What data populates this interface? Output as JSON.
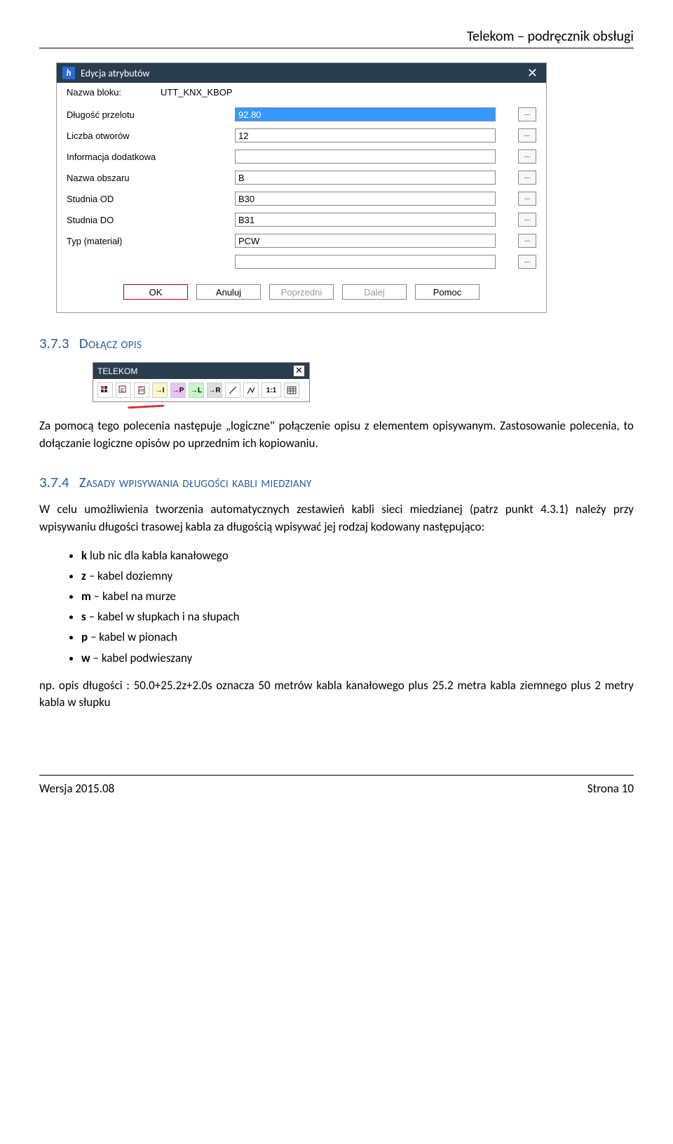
{
  "doc_header": "Telekom – podręcznik obsługi",
  "dialog": {
    "title": "Edycja atrybutów",
    "block_label": "Nazwa bloku:",
    "block_value": "UTT_KNX_KBOP",
    "fields": [
      {
        "label": "Długość przelotu",
        "value": "92.80",
        "selected": true
      },
      {
        "label": "Liczba otworów",
        "value": "12",
        "selected": false
      },
      {
        "label": "Informacja dodatkowa",
        "value": "",
        "selected": false
      },
      {
        "label": "Nazwa obszaru",
        "value": "B",
        "selected": false
      },
      {
        "label": "Studnia OD",
        "value": "B30",
        "selected": false
      },
      {
        "label": "Studnia DO",
        "value": "B31",
        "selected": false
      },
      {
        "label": "Typ (materiał)",
        "value": "PCW",
        "selected": false
      },
      {
        "label": "",
        "value": "",
        "selected": false
      }
    ],
    "buttons": {
      "ok": "OK",
      "cancel": "Anuluj",
      "prev": "Poprzedni",
      "next": "Dalej",
      "help": "Pomoc"
    }
  },
  "section_373": {
    "num": "3.7.3",
    "title": "Dołącz opis",
    "para": "Za pomocą tego polecenia następuje „logiczne\" połączenie opisu z elementem opisywanym. Zastosowanie polecenia, to dołączanie logiczne opisów po uprzednim ich kopiowaniu."
  },
  "toolbar": {
    "title": "TELEKOM",
    "btn_I": "→I",
    "btn_P": "→P",
    "btn_L": "→L",
    "btn_R": "→R",
    "btn_ratio": "1:1"
  },
  "section_374": {
    "num": "3.7.4",
    "title": "Zasady wpisywania długości kabli miedziany",
    "para1": "W celu umożliwienia tworzenia automatycznych zestawień kabli sieci miedzianej (patrz punkt 4.3.1) należy przy wpisywaniu długości trasowej kabla za długością wpisywać jej rodzaj kodowany następująco:",
    "items": [
      {
        "code": "k",
        "text": " lub nic dla kabla kanałowego"
      },
      {
        "code": "z",
        "text": " – kabel doziemny"
      },
      {
        "code": "m",
        "text": " – kabel na murze"
      },
      {
        "code": "s",
        "text": " – kabel w słupkach i na słupach"
      },
      {
        "code": "p",
        "text": " – kabel w pionach"
      },
      {
        "code": "w",
        "text": " – kabel podwieszany"
      }
    ],
    "para2": "np. opis długości :   50.0+25.2z+2.0s oznacza 50 metrów kabla kanałowego plus 25.2 metra kabla ziemnego plus 2 metry kabla w słupku"
  },
  "footer": {
    "left": "Wersja 2015.08",
    "right": "Strona 10"
  }
}
